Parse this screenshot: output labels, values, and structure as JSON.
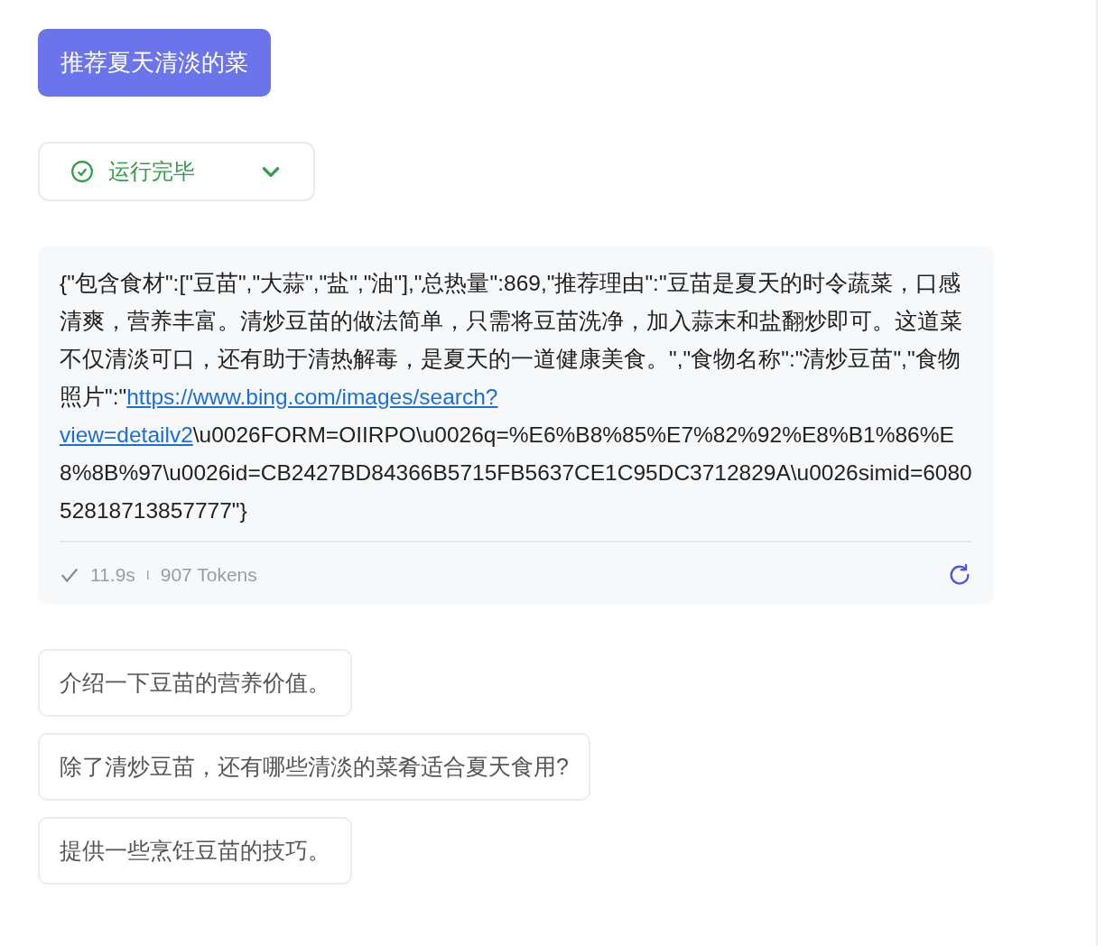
{
  "prompt_button": {
    "label": "推荐夏天清淡的菜"
  },
  "run_status": {
    "label": "运行完毕",
    "expanded": false
  },
  "answer": {
    "text_before": "{\"包含食材\":[\"豆苗\",\"大蒜\",\"盐\",\"油\"],\"总热量\":869,\"推荐理由\":\"豆苗是夏天的时令蔬菜，口感清爽，营养丰富。清炒豆苗的做法简单，只需将豆苗洗净，加入蒜末和盐翻炒即可。这道菜不仅清淡可口，还有助于清热解毒，是夏天的一道健康美食。\",\"食物名称\":\"清炒豆苗\",\"食物照片\":\"",
    "link_lines": [
      "https://www.bing.com/images/search?",
      "view=detailv2"
    ],
    "text_after": "\\u0026FORM=OIIRPO\\u0026q=%E6%B8%85%E7%82%92%E8%B1%86%E8%8B%97\\u0026id=CB2427BD84366B5715FB5637CE1C95DC3712829A\\u0026simid=608052818713857777\"}",
    "duration": "11.9s",
    "separator": "I",
    "tokens": "907 Tokens"
  },
  "suggestions": [
    "介绍一下豆苗的营养价值。",
    "除了清炒豆苗，还有哪些清淡的菜肴适合夏天食用?",
    "提供一些烹饪豆苗的技巧。"
  ]
}
